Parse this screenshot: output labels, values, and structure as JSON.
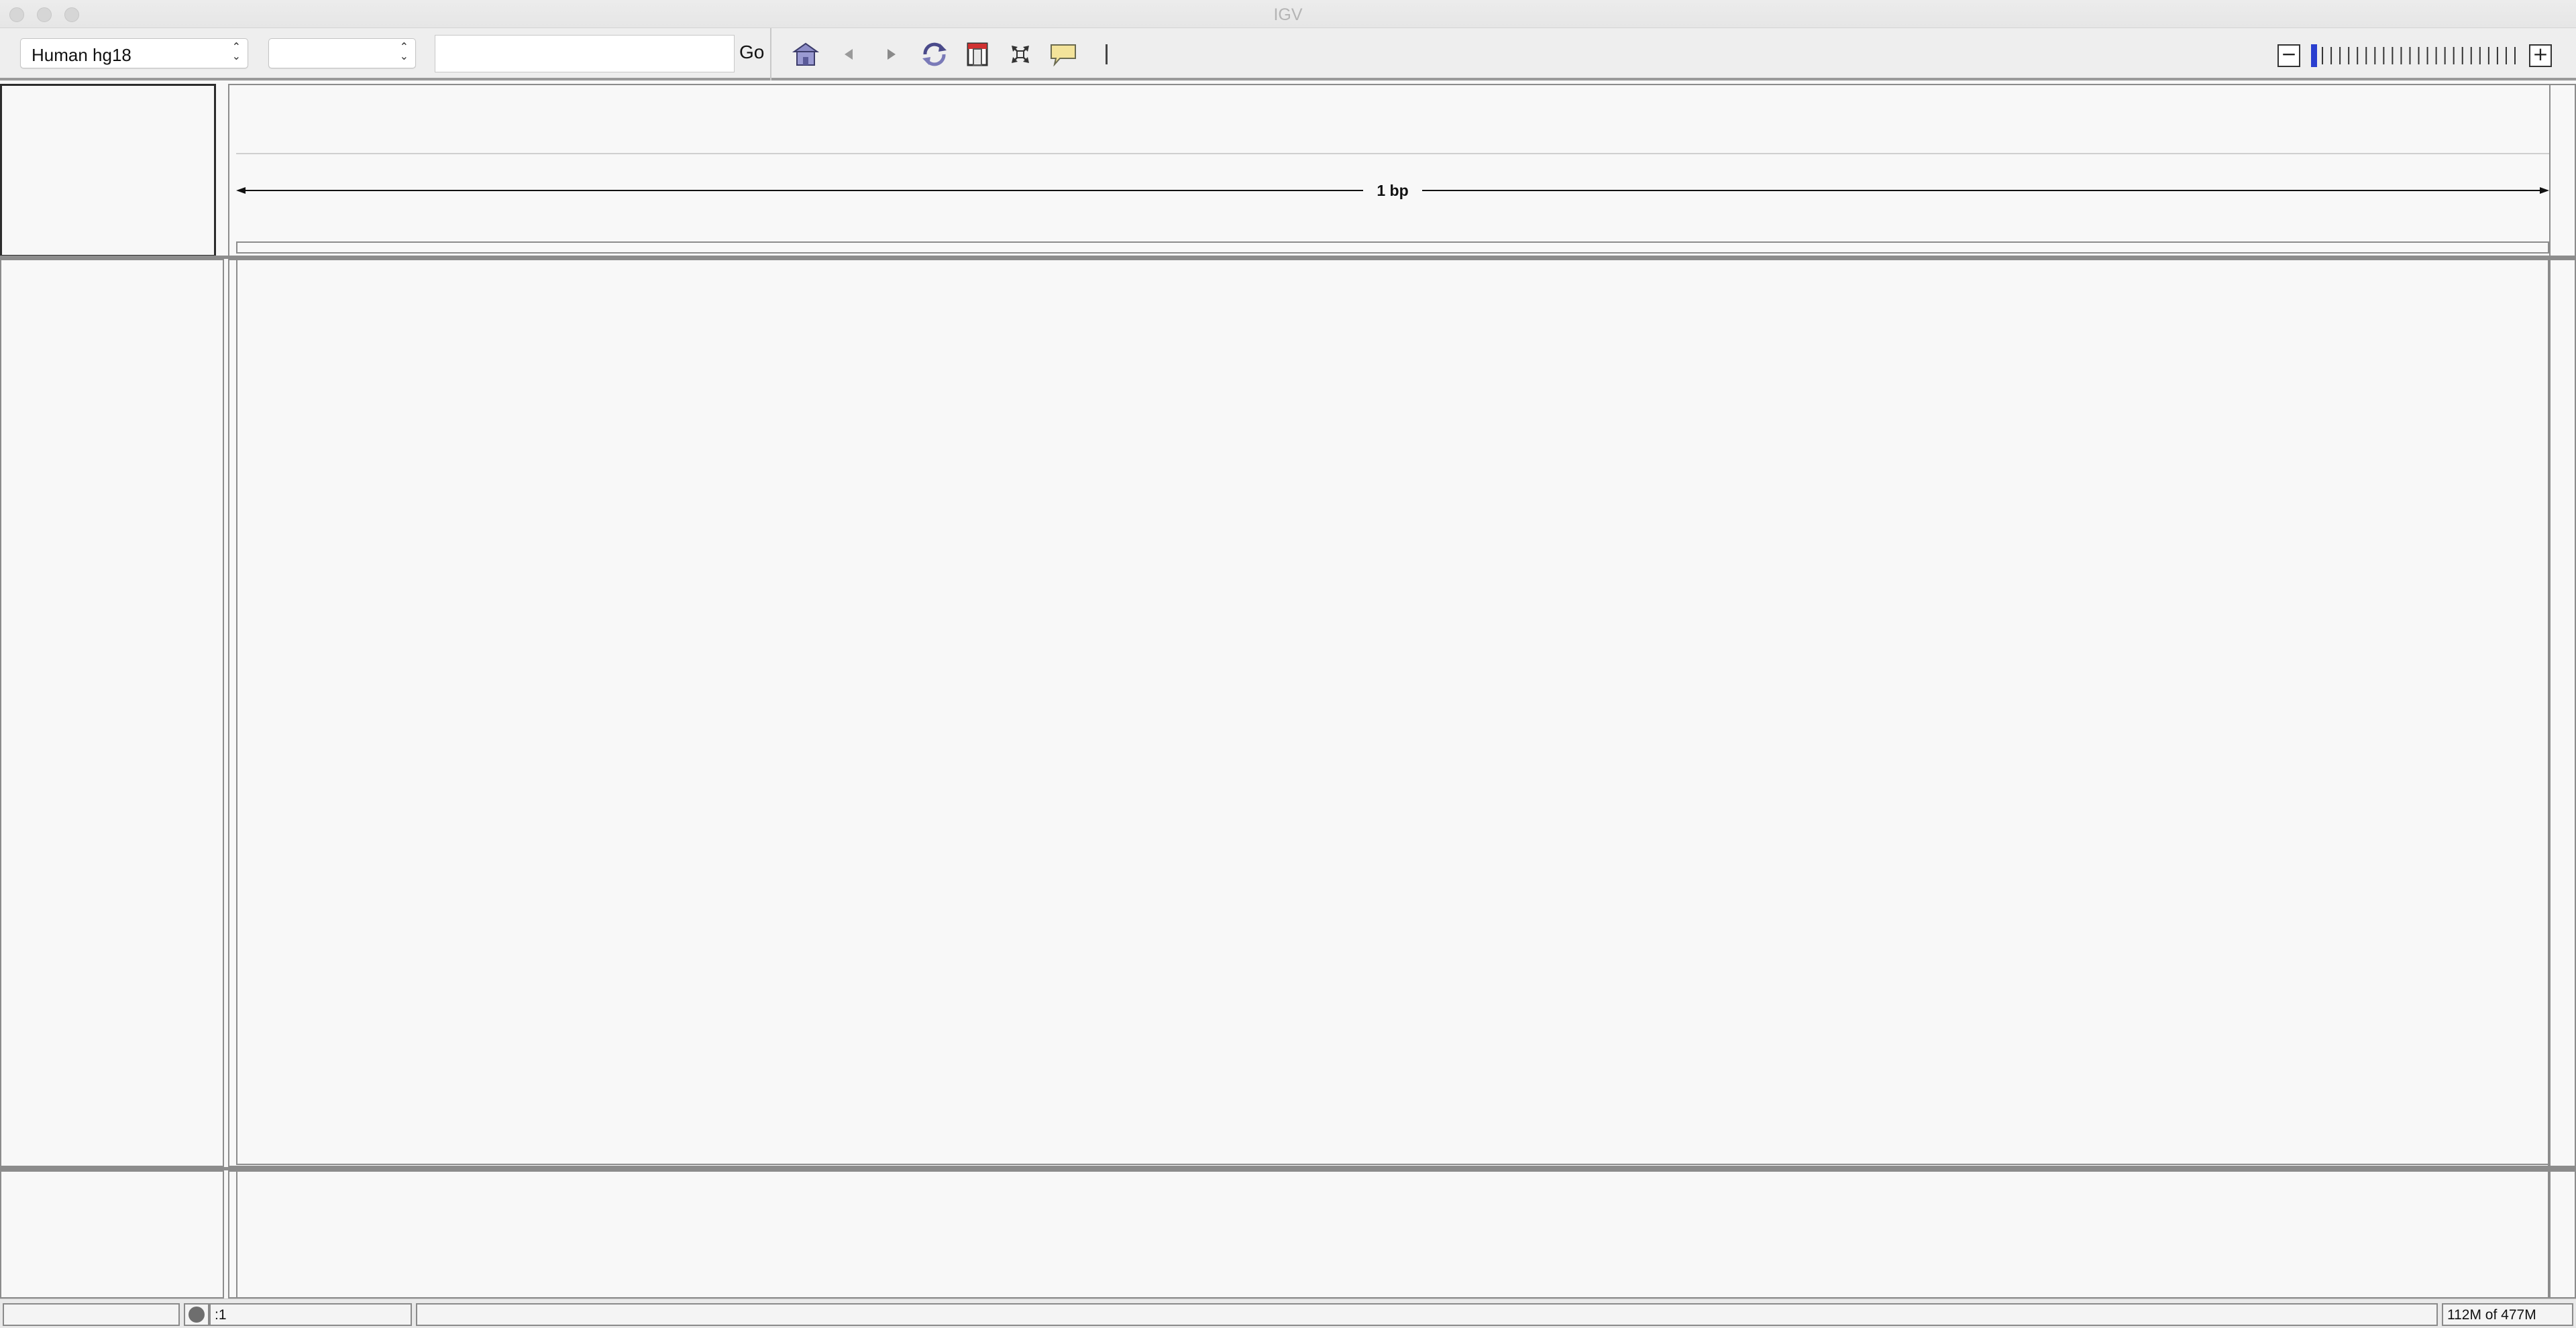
{
  "window": {
    "title": "IGV"
  },
  "toolbar": {
    "genome_select": {
      "value": "Human hg18"
    },
    "chromosome_select": {
      "value": ""
    },
    "locus_input": {
      "value": "",
      "placeholder": ""
    },
    "go_label": "Go",
    "icons": [
      "home-icon",
      "back-arrow-icon",
      "forward-arrow-icon",
      "refresh-icon",
      "region-of-interest-icon",
      "resize-to-window-icon",
      "popup-info-icon",
      "center-line-icon"
    ]
  },
  "zoom": {
    "minus_label": "−",
    "plus_label": "+",
    "level": 0,
    "levels": 24
  },
  "ruler": {
    "span_label": "1 bp"
  },
  "statusbar": {
    "message": "",
    "position": ":1",
    "info": "",
    "memory": "112M of 477M"
  },
  "colors": {
    "accent": "#2a3fcf",
    "toolbar_bg": "#eeeeee",
    "panel_bg": "#f8f8f8",
    "border": "#8c8c8c"
  }
}
